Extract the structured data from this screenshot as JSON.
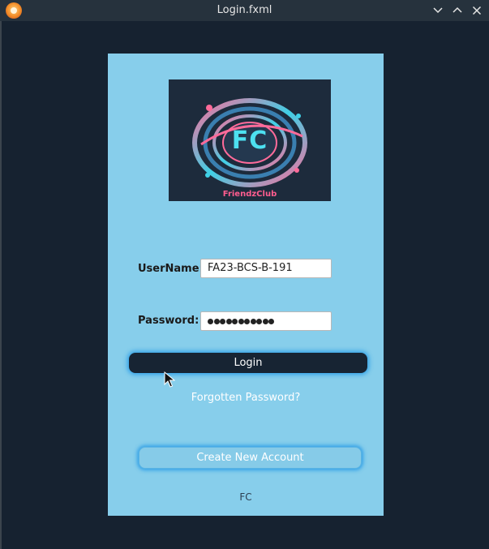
{
  "window": {
    "title": "Login.fxml",
    "app_icon": "app-icon",
    "controls": [
      "chevron-down-icon",
      "chevron-up-icon",
      "close-icon"
    ]
  },
  "logo": {
    "brand_text": "FC",
    "caption": "FriendzClub"
  },
  "form": {
    "username_label": "UserName:",
    "username_value": "FA23-BCS-B-191",
    "password_label": "Password:",
    "password_mask_count": 11,
    "login_label": "Login",
    "forgot_label": "Forgotten Password?",
    "create_label": "Create New Account",
    "footer": "FC"
  },
  "colors": {
    "background": "#162230",
    "panel": "#87ceeb",
    "button_dark": "#172433",
    "glow": "#1e96e6"
  }
}
